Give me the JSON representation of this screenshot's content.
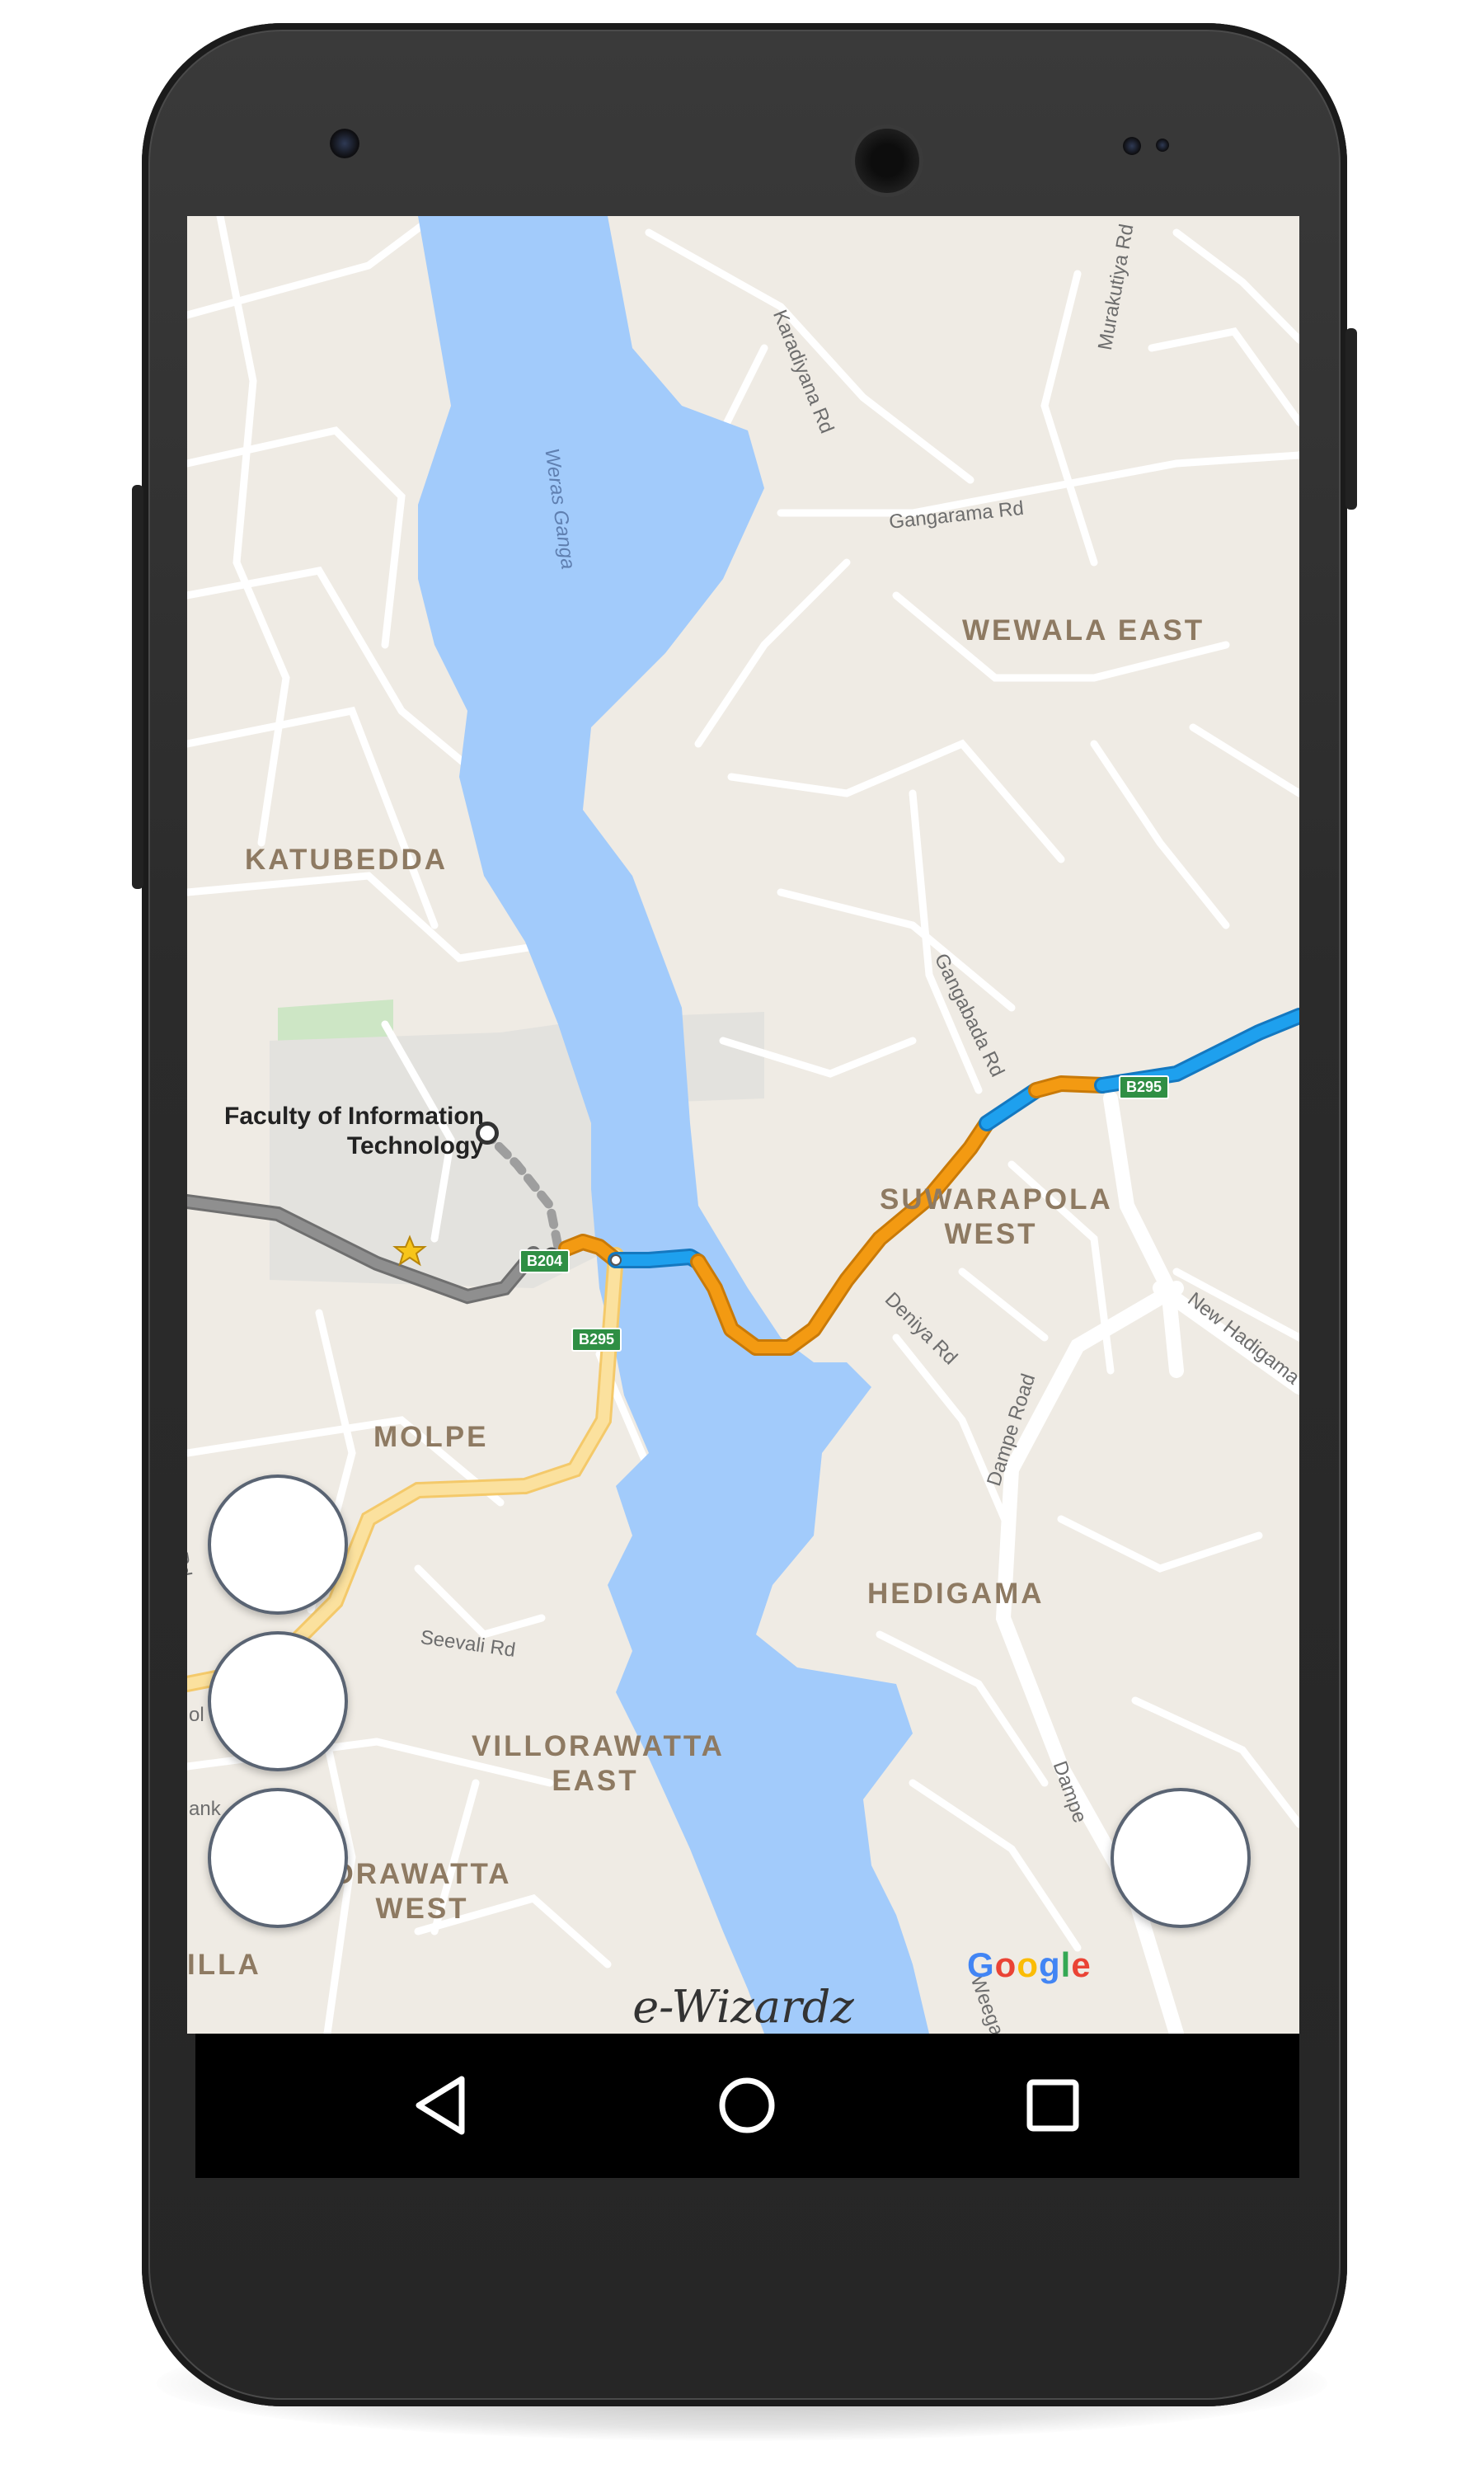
{
  "map": {
    "places": [
      "WEWALA EAST",
      "KATUBEDDA",
      "SUWARAPOLA WEST",
      "MOLPE",
      "HEDIGAMA",
      "VILLORAWATTA EAST",
      "DRAWATTA WEST",
      "ILLA"
    ],
    "roads": [
      "Karadiyana Rd",
      "Murakutiya Rd",
      "Gangarama Rd",
      "Gangabada Rd",
      "Deniya Rd",
      "Dampe Road",
      "New Hadigama",
      "Seevali Rd",
      "Dampe",
      "Weegala",
      "ra Rd",
      "ol",
      "ank"
    ],
    "water": [
      "Weras Ganga"
    ],
    "poi": {
      "line1": "Faculty of Information",
      "line2": "Technology"
    },
    "shields": [
      "B204",
      "B295",
      "B295"
    ],
    "google_logo": "Google",
    "route_colors": {
      "fast": "#1ea0ee",
      "slow": "#f39a12",
      "walk": "#9e9e9e",
      "gray_route": "#808080",
      "secondary": "#fbe19e"
    }
  },
  "watermark": "e-Wizardz",
  "nav": {
    "back": "back-icon",
    "home": "home-icon",
    "recents": "recents-icon"
  },
  "colors": {
    "land": "#efebe4",
    "water": "#a2cbfb",
    "roads": "#ffffff",
    "park": "#cde6c5"
  }
}
